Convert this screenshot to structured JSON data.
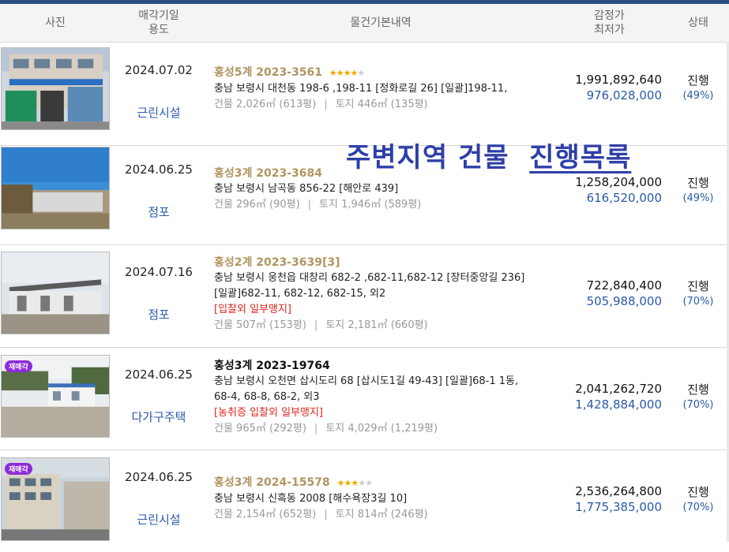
{
  "header": {
    "photo": "사진",
    "date_line1": "매각기일",
    "date_line2": "용도",
    "info": "물건기본내역",
    "price_line1": "감정가",
    "price_line2": "최저가",
    "status": "상태"
  },
  "overlay": {
    "part1": "주변지역 건물",
    "part2": "진행목록"
  },
  "rows": [
    {
      "date": "2024.07.02",
      "usage": "근린시설",
      "court": "홍성5계",
      "case_no": "2023-3561",
      "stars": 4,
      "address": "충남 보령시 대천동 198-6 ,198-11 [정화로길 26]  [일괄]198-11,",
      "address2": "",
      "flags": "",
      "building": "건물 2,026㎡ (613평)",
      "land": "토지 446㎡ (135평)",
      "appraisal": "1,991,892,640",
      "minimum": "976,028,000",
      "status": "진행",
      "percent": "(49%)"
    },
    {
      "date": "2024.06.25",
      "usage": "점포",
      "court": "홍성3계",
      "case_no": "2023-3684",
      "stars": 0,
      "address": "충남 보령시 남곡동 856-22 [해안로 439]",
      "address2": "",
      "flags": "",
      "building": "건물 296㎡ (90평)",
      "land": "토지 1,946㎡ (589평)",
      "appraisal": "1,258,204,000",
      "minimum": "616,520,000",
      "status": "진행",
      "percent": "(49%)"
    },
    {
      "date": "2024.07.16",
      "usage": "점포",
      "court": "홍성2계",
      "case_no": "2023-3639[3]",
      "stars": 0,
      "address": "충남 보령시 웅천읍 대창리 682-2 ,682-11,682-12 [장터중앙길 236]",
      "address2": "[일괄]682-11, 682-12, 682-15, 외2",
      "flags": "[입찰외   일부맹지]",
      "building": "건물 507㎡ (153평)",
      "land": "토지 2,181㎡ (660평)",
      "appraisal": "722,840,400",
      "minimum": "505,988,000",
      "status": "진행",
      "percent": "(70%)"
    },
    {
      "date": "2024.06.25",
      "usage": "다가구주택",
      "court": "홍성3계",
      "case_no": "2023-19764",
      "stars": 0,
      "address": "충남 보령시 오천면 삽시도리 68 [삽시도1길 49-43]  [일괄]68-1 1동,",
      "address2": "68-4, 68-8, 68-2, 외3",
      "flags": "[농취증   입찰외   일부맹지]",
      "building": "건물 965㎡ (292평)",
      "land": "토지 4,029㎡ (1,219평)",
      "appraisal": "2,041,262,720",
      "minimum": "1,428,884,000",
      "status": "진행",
      "percent": "(70%)",
      "badge": "재매각"
    },
    {
      "date": "2024.06.25",
      "usage": "근린시설",
      "court": "홍성3계",
      "case_no": "2024-15578",
      "stars": 3,
      "address": "충남 보령시 신흑동 2008 [해수욕장3길 10]",
      "address2": "",
      "flags": "",
      "building": "건물 2,154㎡ (652평)",
      "land": "토지 814㎡ (246평)",
      "appraisal": "2,536,264,800",
      "minimum": "1,775,385,000",
      "status": "진행",
      "percent": "(70%)",
      "badge": "재매각"
    }
  ],
  "colors": {
    "accent_blue": "#2a5aa8",
    "case_gold": "#b19561",
    "flag_red": "#e0241b",
    "overlay": "#2f3fa8"
  }
}
